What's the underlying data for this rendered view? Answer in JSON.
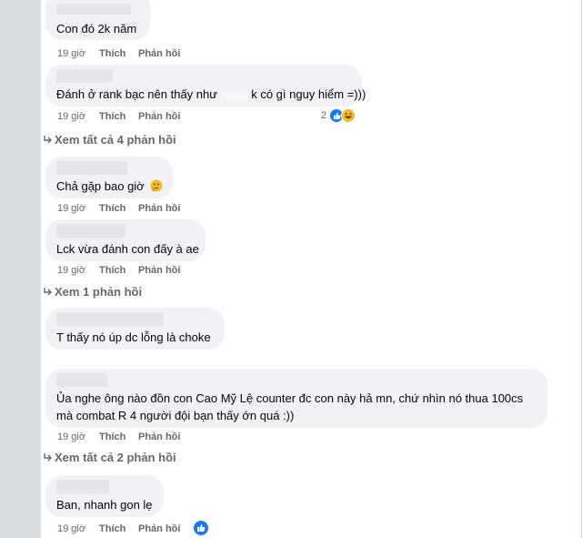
{
  "comments": [
    {
      "text": "Con đó 2k năm",
      "time": "19 giờ",
      "like": "Thích",
      "reply": "Phản hồi"
    },
    {
      "text_before": "Đánh ở rank bạc nên thấy như",
      "text_after": "k có gì nguy hiểm =)))",
      "time": "19 giờ",
      "like": "Thích",
      "reply": "Phản hồi",
      "reaction_count": "2"
    },
    {
      "text": "Chả gặp bao giờ",
      "time": "19 giờ",
      "like": "Thích",
      "reply": "Phản hồi"
    },
    {
      "text": "Lck vừa đánh con đấy à ae",
      "time": "19 giờ",
      "like": "Thích",
      "reply": "Phản hồi"
    },
    {
      "text": "T thấy nó úp dc lỗng là choke"
    },
    {
      "line1": "Ủa nghe ông nào đồn con Cao Mỹ Lệ counter đc con này hả mn, chứ nhìn nó thua 100cs",
      "line2": "mà combat R 4 người đội bạn thấy ớn quá :))",
      "time": "19 giờ",
      "like": "Thích",
      "reply": "Phản hồi"
    },
    {
      "text": "Ban, nhanh gon lẹ",
      "time": "19 giờ",
      "like": "Thích",
      "reply": "Phản hồi"
    }
  ],
  "view_replies": [
    "Xem tất cả 4 phản hồi",
    "Xem 1 phản hồi",
    "Xem tất cả 2 phản hồi"
  ],
  "colors": {
    "bubble": "#f0f2f5",
    "meta_text": "#65676b",
    "like_blue": "#1877f2",
    "haha_yellow": "#f7b928"
  }
}
